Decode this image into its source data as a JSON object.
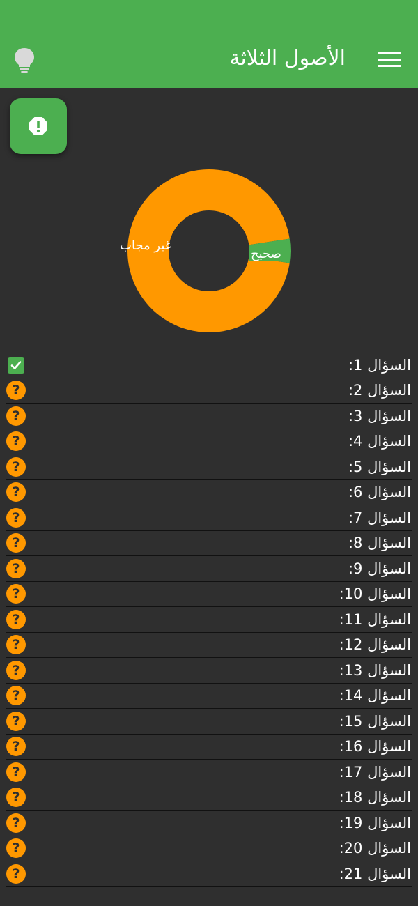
{
  "header": {
    "title": "الأصول الثلاثة",
    "menu_icon": "menu-icon",
    "hint_icon": "lightbulb-icon"
  },
  "fab": {
    "icon": "alert-octagon-icon"
  },
  "colors": {
    "primary": "#4caf50",
    "unanswered": "#ff9800",
    "background": "#2f2f2f",
    "divider": "#111111"
  },
  "chart_data": {
    "type": "pie",
    "variant": "donut",
    "categories": [
      "غير مجاب",
      "صحيح"
    ],
    "values": [
      20,
      1
    ],
    "colors": [
      "#ff9800",
      "#4caf50"
    ]
  },
  "questions": [
    {
      "label": "السؤال 1:",
      "status": "correct"
    },
    {
      "label": "السؤال 2:",
      "status": "unanswered"
    },
    {
      "label": "السؤال 3:",
      "status": "unanswered"
    },
    {
      "label": "السؤال 4:",
      "status": "unanswered"
    },
    {
      "label": "السؤال 5:",
      "status": "unanswered"
    },
    {
      "label": "السؤال 6:",
      "status": "unanswered"
    },
    {
      "label": "السؤال 7:",
      "status": "unanswered"
    },
    {
      "label": "السؤال 8:",
      "status": "unanswered"
    },
    {
      "label": "السؤال 9:",
      "status": "unanswered"
    },
    {
      "label": "السؤال 10:",
      "status": "unanswered"
    },
    {
      "label": "السؤال 11:",
      "status": "unanswered"
    },
    {
      "label": "السؤال 12:",
      "status": "unanswered"
    },
    {
      "label": "السؤال 13:",
      "status": "unanswered"
    },
    {
      "label": "السؤال 14:",
      "status": "unanswered"
    },
    {
      "label": "السؤال 15:",
      "status": "unanswered"
    },
    {
      "label": "السؤال 16:",
      "status": "unanswered"
    },
    {
      "label": "السؤال 17:",
      "status": "unanswered"
    },
    {
      "label": "السؤال 18:",
      "status": "unanswered"
    },
    {
      "label": "السؤال 19:",
      "status": "unanswered"
    },
    {
      "label": "السؤال 20:",
      "status": "unanswered"
    },
    {
      "label": "السؤال 21:",
      "status": "unanswered"
    }
  ]
}
